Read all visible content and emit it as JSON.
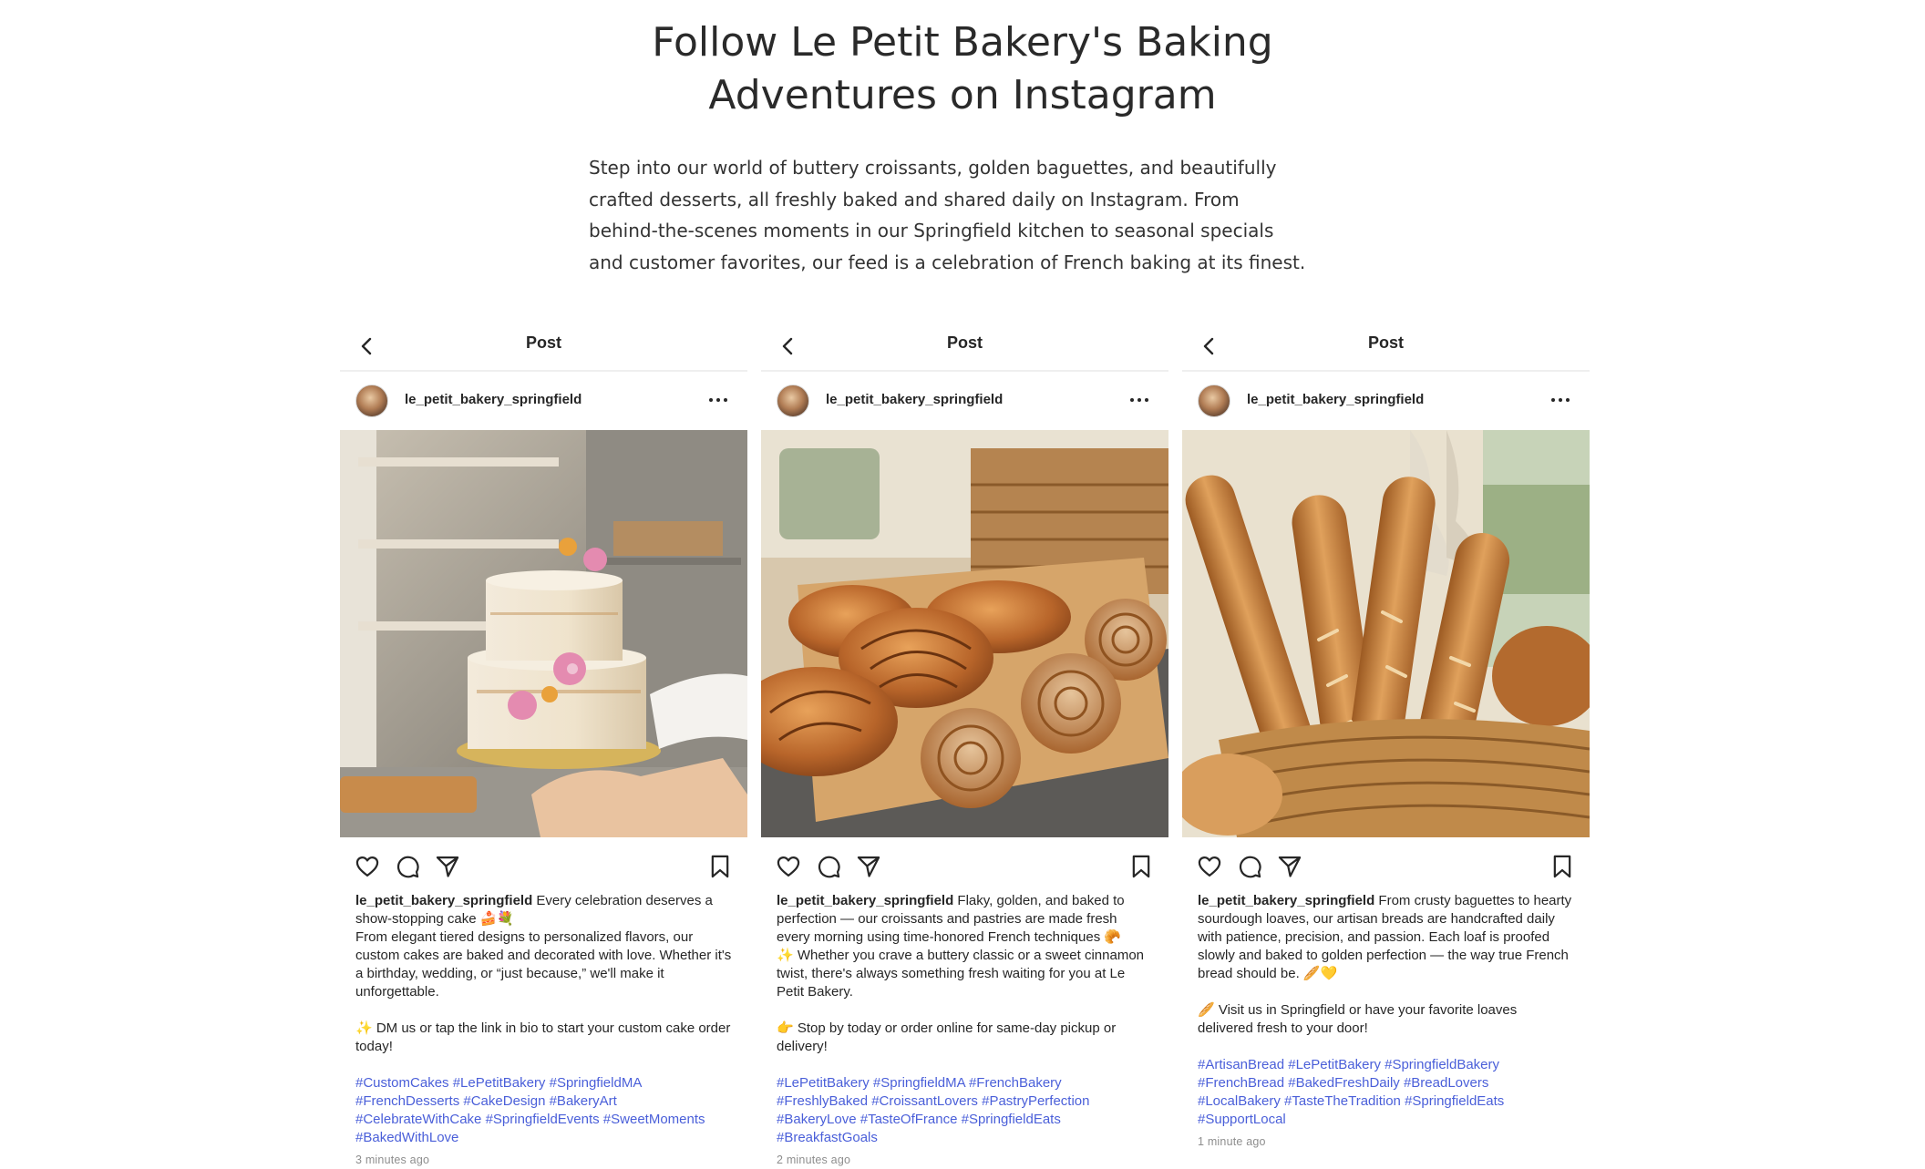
{
  "page": {
    "title_line1": "Follow Le Petit Bakery's Baking",
    "title_line2": "Adventures on Instagram",
    "intro": "Step into our world of buttery croissants, golden baguettes, and beautifully crafted desserts, all freshly baked and shared daily on Instagram. From behind-the-scenes moments in our Springfield kitchen to seasonal specials and customer favorites, our feed is a celebration of French baking at its finest."
  },
  "posts": [
    {
      "header_title": "Post",
      "username": "le_petit_bakery_springfield",
      "photo_alt": "Two-tier semi-naked cake with pink flowers held in a bakery",
      "caption_user": "le_petit_bakery_springfield",
      "caption_first": " Every celebration deserves a show-stopping cake 🍰💐",
      "caption_body": "From elegant tiered designs to personalized flavors, our custom cakes are baked and decorated with love. Whether it's a birthday, wedding, or “just because,” we'll make it unforgettable.",
      "caption_cta": "✨ DM us or tap the link in bio to start your custom cake order today!",
      "hashtags": "#CustomCakes #LePetitBakery #SpringfieldMA #FrenchDesserts #CakeDesign #BakeryArt #CelebrateWithCake #SpringfieldEvents #SweetMoments #BakedWithLove",
      "time": "3 minutes ago"
    },
    {
      "header_title": "Post",
      "username": "le_petit_bakery_springfield",
      "photo_alt": "Croissants and cinnamon pastries on a baking tray",
      "caption_user": "le_petit_bakery_springfield",
      "caption_first": " Flaky, golden, and baked to perfection — our croissants and pastries are made fresh every morning using time-honored French techniques 🥐",
      "caption_body": "✨ Whether you crave a buttery classic or a sweet cinnamon twist, there's always something fresh waiting for you at Le Petit Bakery.",
      "caption_cta": "👉 Stop by today or order online for same-day pickup or delivery!",
      "hashtags": "#LePetitBakery #SpringfieldMA #FrenchBakery #FreshlyBaked #CroissantLovers #PastryPerfection #BakeryLove #TasteOfFrance #SpringfieldEats #BreakfastGoals",
      "time": "2 minutes ago"
    },
    {
      "header_title": "Post",
      "username": "le_petit_bakery_springfield",
      "photo_alt": "Baguettes and sourdough loaves in a wicker basket",
      "caption_user": "le_petit_bakery_springfield",
      "caption_first": " From crusty baguettes to hearty sourdough loaves, our artisan breads are handcrafted daily with patience, precision, and passion. Each loaf is proofed slowly and baked to golden perfection — the way true French bread should be. 🥖💛",
      "caption_body": "",
      "caption_cta": "🥖 Visit us in Springfield or have your favorite loaves delivered fresh to your door!",
      "hashtags": "#ArtisanBread #LePetitBakery #SpringfieldBakery #FrenchBread #BakedFreshDaily #BreadLovers #LocalBakery #TasteTheTradition #SpringfieldEats #SupportLocal",
      "time": "1 minute ago"
    }
  ],
  "icons": {
    "back": "chevron-left-icon",
    "more": "more-horizontal-icon",
    "like": "heart-icon",
    "comment": "comment-bubble-icon",
    "share": "send-icon",
    "save": "bookmark-icon"
  },
  "colors": {
    "hashtag": "#4a5fd9",
    "timestamp": "#8e8e8e",
    "divider": "#efefef"
  }
}
